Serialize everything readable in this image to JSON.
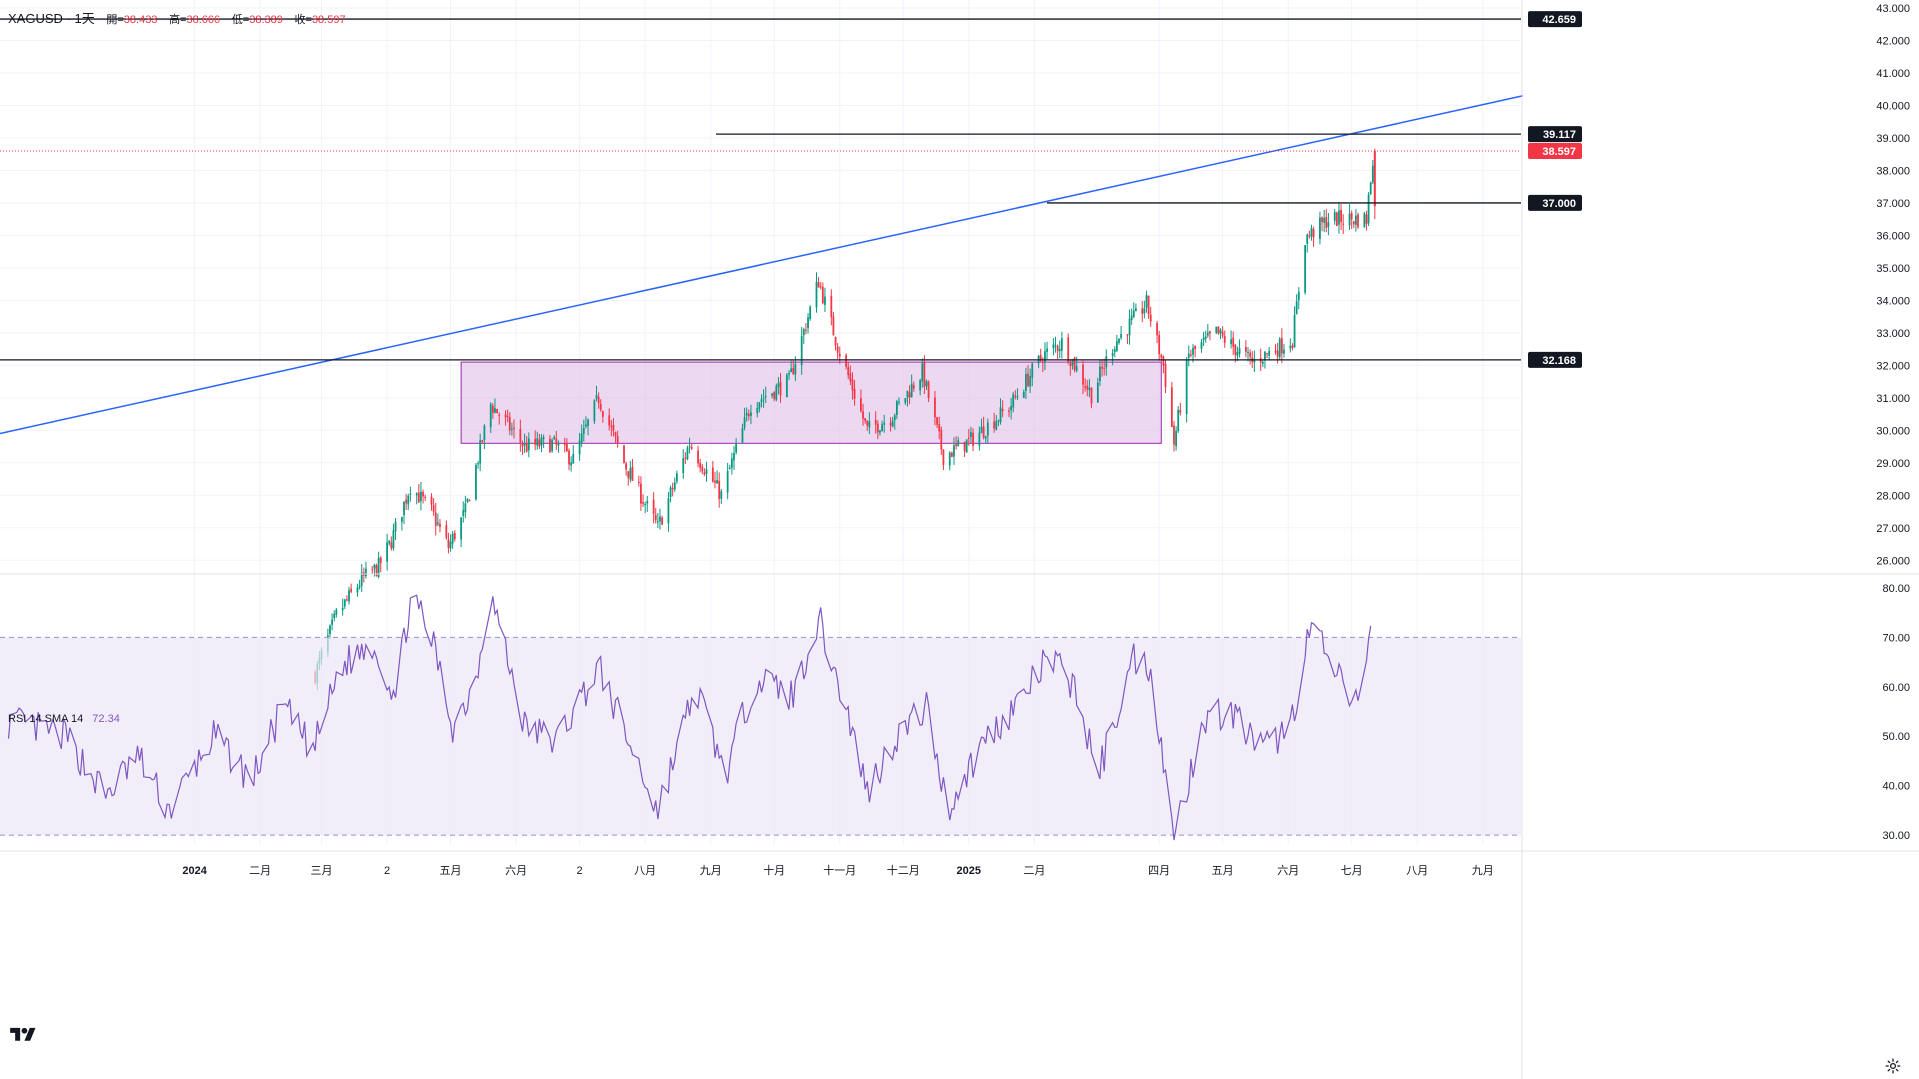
{
  "header": {
    "symbol": "XAGUSD",
    "interval": "1天",
    "open_label": "開=",
    "open": "38.433",
    "high_label": "高=",
    "high": "38.666",
    "low_label": "低=",
    "low": "38.389",
    "close_label": "收=",
    "close": "38.597"
  },
  "rsi_header": {
    "label": "RSI 14 SMA 14",
    "value": "72.34"
  },
  "colors": {
    "up": "#089981",
    "down": "#f23645",
    "trendline": "#2962ff",
    "rsi_line": "#7e57c2",
    "rsi_band": "#ede7f6",
    "range_box": "#e1bee7",
    "level": "#131722"
  },
  "icons": [
    "tradingview-logo-icon",
    "settings-gear-icon"
  ],
  "chart_data": [
    {
      "type": "candlestick",
      "symbol": "XAGUSD",
      "ylim": [
        25.7,
        43.0
      ],
      "y_ticks": [
        "26.000",
        "27.000",
        "28.000",
        "29.000",
        "30.000",
        "31.000",
        "32.000",
        "33.000",
        "34.000",
        "35.000",
        "36.000",
        "37.000",
        "38.000",
        "39.000",
        "40.000",
        "41.000",
        "42.000",
        "43.000"
      ],
      "x_ticks": [
        "2024",
        "二月",
        "三月",
        "2",
        "五月",
        "六月",
        "2",
        "八月",
        "九月",
        "十月",
        "十一月",
        "十二月",
        "2025",
        "二月",
        "四月",
        "五月",
        "六月",
        "七月",
        "八月",
        "九月"
      ],
      "x_tick_bold": [
        true,
        false,
        false,
        false,
        false,
        false,
        false,
        false,
        false,
        false,
        false,
        false,
        true,
        false,
        false,
        false,
        false,
        false,
        false,
        false
      ],
      "horizontal_levels": [
        {
          "value": 42.659,
          "label": "42.659"
        },
        {
          "value": 39.117,
          "label": "39.117"
        },
        {
          "value": 37.0,
          "label": "37.000"
        },
        {
          "value": 32.168,
          "label": "32.168"
        }
      ],
      "last_price": {
        "value": 38.597,
        "label": "38.597"
      },
      "trendline": [
        {
          "date": "2023-10-01",
          "value": 29.9
        },
        {
          "date": "2025-09-20",
          "value": 40.3
        }
      ],
      "range_box": {
        "from": "2024-05-06",
        "to": "2025-04-02",
        "top": 32.1,
        "bottom": 29.6
      },
      "price_path": [
        {
          "date": "2024-02-27",
          "value": 22.5
        },
        {
          "date": "2024-03-08",
          "value": 24.3
        },
        {
          "date": "2024-03-20",
          "value": 25.4
        },
        {
          "date": "2024-03-28",
          "value": 25.8
        },
        {
          "date": "2024-04-03",
          "value": 26.6
        },
        {
          "date": "2024-04-12",
          "value": 28.3
        },
        {
          "date": "2024-04-22",
          "value": 27.5
        },
        {
          "date": "2024-04-30",
          "value": 26.4
        },
        {
          "date": "2024-05-08",
          "value": 27.5
        },
        {
          "date": "2024-05-20",
          "value": 30.8
        },
        {
          "date": "2024-05-24",
          "value": 30.5
        },
        {
          "date": "2024-06-05",
          "value": 29.5
        },
        {
          "date": "2024-06-18",
          "value": 29.6
        },
        {
          "date": "2024-06-28",
          "value": 29.1
        },
        {
          "date": "2024-07-10",
          "value": 31.0
        },
        {
          "date": "2024-07-22",
          "value": 29.0
        },
        {
          "date": "2024-08-07",
          "value": 27.0
        },
        {
          "date": "2024-08-22",
          "value": 29.6
        },
        {
          "date": "2024-09-06",
          "value": 28.0
        },
        {
          "date": "2024-09-20",
          "value": 30.8
        },
        {
          "date": "2024-10-08",
          "value": 31.5
        },
        {
          "date": "2024-10-22",
          "value": 34.6
        },
        {
          "date": "2024-10-31",
          "value": 32.6
        },
        {
          "date": "2024-11-14",
          "value": 30.0
        },
        {
          "date": "2024-11-25",
          "value": 30.4
        },
        {
          "date": "2024-12-10",
          "value": 31.8
        },
        {
          "date": "2024-12-20",
          "value": 29.2
        },
        {
          "date": "2025-01-02",
          "value": 29.7
        },
        {
          "date": "2025-01-20",
          "value": 30.7
        },
        {
          "date": "2025-02-05",
          "value": 32.3
        },
        {
          "date": "2025-02-14",
          "value": 32.7
        },
        {
          "date": "2025-02-28",
          "value": 31.1
        },
        {
          "date": "2025-03-10",
          "value": 32.6
        },
        {
          "date": "2025-03-26",
          "value": 33.9
        },
        {
          "date": "2025-04-03",
          "value": 32.0
        },
        {
          "date": "2025-04-08",
          "value": 29.6
        },
        {
          "date": "2025-04-15",
          "value": 32.3
        },
        {
          "date": "2025-04-28",
          "value": 33.0
        },
        {
          "date": "2025-05-15",
          "value": 32.1
        },
        {
          "date": "2025-06-03",
          "value": 32.8
        },
        {
          "date": "2025-06-09",
          "value": 35.9
        },
        {
          "date": "2025-06-20",
          "value": 36.5
        },
        {
          "date": "2025-07-03",
          "value": 36.5
        },
        {
          "date": "2025-07-08",
          "value": 36.5
        },
        {
          "date": "2025-07-11",
          "value": 38.4
        }
      ]
    },
    {
      "type": "line",
      "name": "RSI 14 SMA 14",
      "ylim": [
        28,
        82
      ],
      "y_ticks": [
        "30.00",
        "40.00",
        "50.00",
        "60.00",
        "70.00",
        "80.00"
      ],
      "band": [
        30,
        70
      ],
      "last_value": 72.34,
      "path": [
        {
          "date": "2023-10-05",
          "value": 53
        },
        {
          "date": "2023-11-01",
          "value": 50
        },
        {
          "date": "2023-11-20",
          "value": 38
        },
        {
          "date": "2023-12-05",
          "value": 46
        },
        {
          "date": "2023-12-20",
          "value": 35
        },
        {
          "date": "2024-01-10",
          "value": 50
        },
        {
          "date": "2024-01-28",
          "value": 41
        },
        {
          "date": "2024-02-12",
          "value": 56
        },
        {
          "date": "2024-02-26",
          "value": 47
        },
        {
          "date": "2024-03-10",
          "value": 64
        },
        {
          "date": "2024-03-25",
          "value": 69
        },
        {
          "date": "2024-04-05",
          "value": 58
        },
        {
          "date": "2024-04-12",
          "value": 78
        },
        {
          "date": "2024-04-22",
          "value": 70
        },
        {
          "date": "2024-05-02",
          "value": 52
        },
        {
          "date": "2024-05-12",
          "value": 60
        },
        {
          "date": "2024-05-20",
          "value": 79
        },
        {
          "date": "2024-06-05",
          "value": 52
        },
        {
          "date": "2024-06-20",
          "value": 49
        },
        {
          "date": "2024-07-10",
          "value": 64
        },
        {
          "date": "2024-07-25",
          "value": 48
        },
        {
          "date": "2024-08-07",
          "value": 35
        },
        {
          "date": "2024-08-25",
          "value": 60
        },
        {
          "date": "2024-09-08",
          "value": 42
        },
        {
          "date": "2024-09-22",
          "value": 62
        },
        {
          "date": "2024-10-10",
          "value": 58
        },
        {
          "date": "2024-10-22",
          "value": 74
        },
        {
          "date": "2024-11-05",
          "value": 54
        },
        {
          "date": "2024-11-14",
          "value": 39
        },
        {
          "date": "2024-11-28",
          "value": 50
        },
        {
          "date": "2024-12-12",
          "value": 56
        },
        {
          "date": "2024-12-22",
          "value": 35
        },
        {
          "date": "2025-01-08",
          "value": 49
        },
        {
          "date": "2025-01-25",
          "value": 57
        },
        {
          "date": "2025-02-08",
          "value": 66
        },
        {
          "date": "2025-02-20",
          "value": 60
        },
        {
          "date": "2025-03-03",
          "value": 42
        },
        {
          "date": "2025-03-20",
          "value": 66
        },
        {
          "date": "2025-03-28",
          "value": 64
        },
        {
          "date": "2025-04-08",
          "value": 29
        },
        {
          "date": "2025-04-22",
          "value": 54
        },
        {
          "date": "2025-05-05",
          "value": 55
        },
        {
          "date": "2025-05-20",
          "value": 47
        },
        {
          "date": "2025-06-02",
          "value": 52
        },
        {
          "date": "2025-06-12",
          "value": 73
        },
        {
          "date": "2025-06-22",
          "value": 63
        },
        {
          "date": "2025-07-04",
          "value": 56
        },
        {
          "date": "2025-07-10",
          "value": 72.34
        }
      ]
    }
  ]
}
